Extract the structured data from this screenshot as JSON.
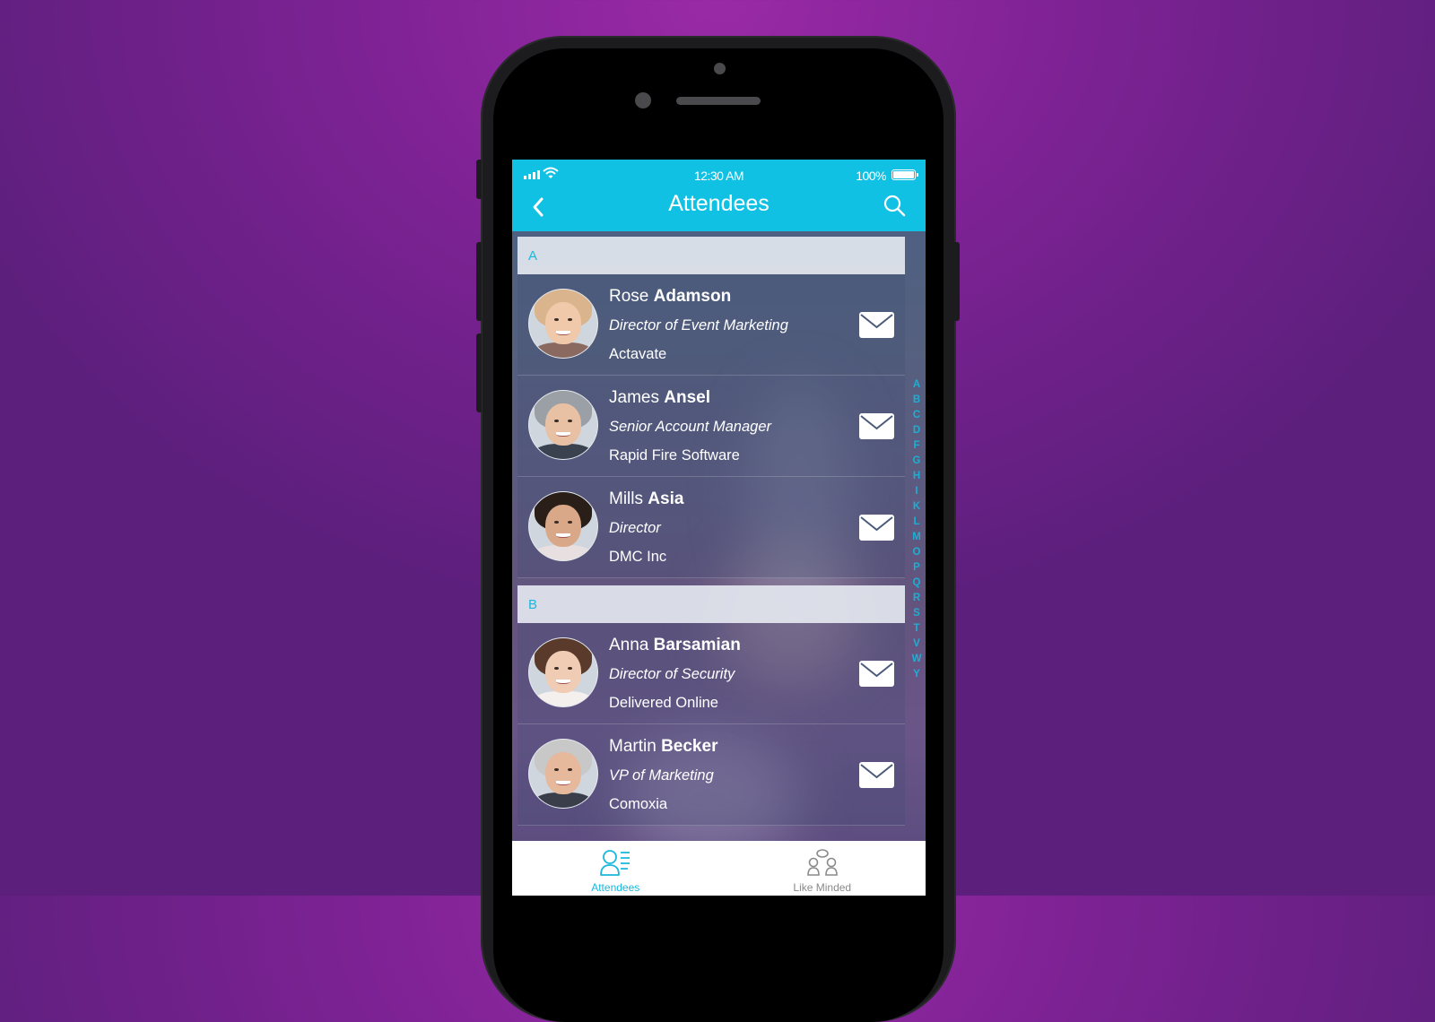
{
  "status_bar": {
    "time": "12:30 AM",
    "battery": "100%"
  },
  "nav": {
    "title": "Attendees",
    "back_icon": "chevron-left-icon",
    "search_icon": "search-icon"
  },
  "sections": [
    {
      "letter": "A",
      "contacts": [
        {
          "first": "Rose",
          "last": "Adamson",
          "title": "Director of Event Marketing",
          "company": "Actavate",
          "avatar": {
            "hair": "#d9b48c",
            "skin": "#f0c8aa",
            "body": "#8a6a60"
          }
        },
        {
          "first": "James",
          "last": "Ansel",
          "title": "Senior Account Manager",
          "company": "Rapid Fire Software",
          "avatar": {
            "hair": "#9aa0a6",
            "skin": "#e8c0a4",
            "body": "#3a4250"
          }
        },
        {
          "first": "Mills",
          "last": "Asia",
          "title": "Director",
          "company": "DMC Inc",
          "avatar": {
            "hair": "#2a1e18",
            "skin": "#d8a888",
            "body": "#e8e0e0"
          }
        }
      ]
    },
    {
      "letter": "B",
      "contacts": [
        {
          "first": "Anna",
          "last": "Barsamian",
          "title": "Director of Security",
          "company": "Delivered Online",
          "avatar": {
            "hair": "#5a3a2a",
            "skin": "#f0ccb4",
            "body": "#f4f0ee"
          }
        },
        {
          "first": "Martin",
          "last": "Becker",
          "title": "VP of Marketing",
          "company": "Comoxia",
          "avatar": {
            "hair": "#c8c8c8",
            "skin": "#e6b89c",
            "body": "#3a3e4a"
          }
        }
      ]
    }
  ],
  "index_letters": [
    "A",
    "B",
    "C",
    "D",
    "F",
    "G",
    "H",
    "I",
    "K",
    "L",
    "M",
    "O",
    "P",
    "Q",
    "R",
    "S",
    "T",
    "V",
    "W",
    "Y"
  ],
  "tabs": [
    {
      "label": "Attendees",
      "icon": "attendees-icon",
      "active": true
    },
    {
      "label": "Like Minded",
      "icon": "like-minded-icon",
      "active": false
    }
  ],
  "colors": {
    "accent": "#11c1e4",
    "background": "#7d2294",
    "section_header_text": "#19b7dc"
  }
}
